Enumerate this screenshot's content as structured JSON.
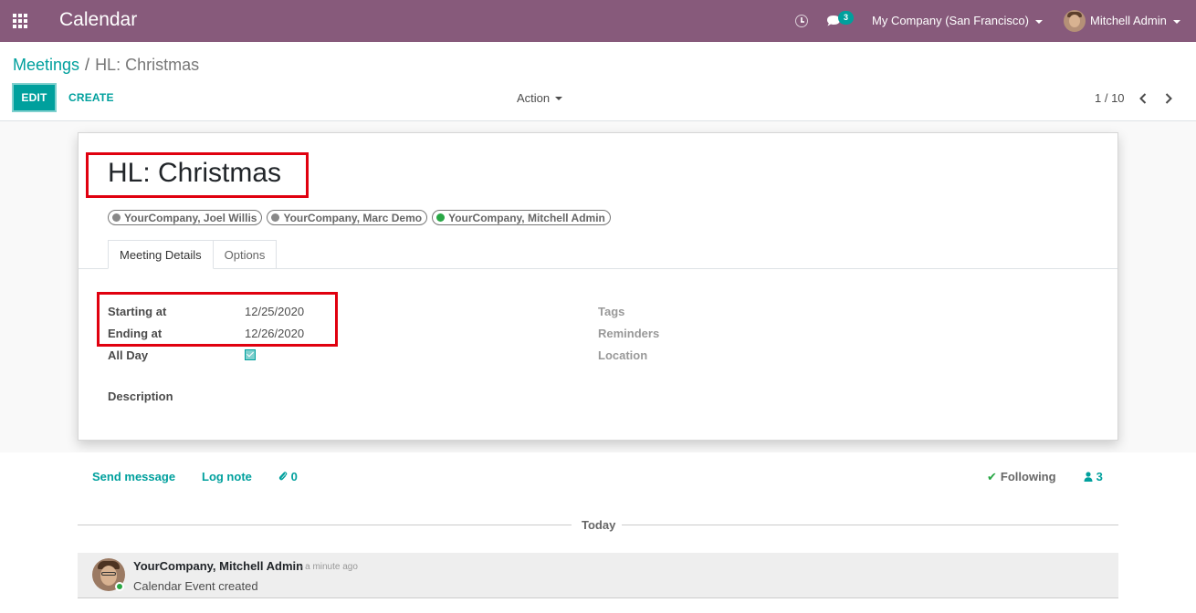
{
  "navbar": {
    "app_title": "Calendar",
    "chat_count": "3",
    "company": "My Company (San Francisco)",
    "user": "Mitchell Admin",
    "color": "#875a7b"
  },
  "control_panel": {
    "breadcrumb_parent": "Meetings",
    "breadcrumb_separator": "/",
    "breadcrumb_current": "HL: Christmas",
    "edit_label": "EDIT",
    "create_label": "CREATE",
    "action_label": "Action",
    "pager": "1 / 10"
  },
  "form": {
    "title": "HL: Christmas",
    "attendees": [
      {
        "name": "YourCompany, Joel Willis",
        "status": "offline"
      },
      {
        "name": "YourCompany, Marc Demo",
        "status": "offline"
      },
      {
        "name": "YourCompany, Mitchell Admin",
        "status": "online"
      }
    ],
    "tabs": [
      "Meeting Details",
      "Options"
    ],
    "active_tab": "Meeting Details",
    "fields_left": {
      "starting_at_label": "Starting at",
      "starting_at_value": "12/25/2020",
      "ending_at_label": "Ending at",
      "ending_at_value": "12/26/2020",
      "all_day_label": "All Day",
      "all_day_checked": true,
      "description_label": "Description"
    },
    "fields_right": {
      "tags_label": "Tags",
      "reminders_label": "Reminders",
      "location_label": "Location"
    }
  },
  "chatter": {
    "send_message": "Send message",
    "log_note": "Log note",
    "attachments": "0",
    "following": "Following",
    "followers": "3",
    "day_separator": "Today",
    "message": {
      "author": "YourCompany, Mitchell Admin",
      "time": "- a minute ago",
      "body": "Calendar Event created"
    }
  },
  "accent_color": "#00a09d",
  "highlight_color": "#e0000f"
}
